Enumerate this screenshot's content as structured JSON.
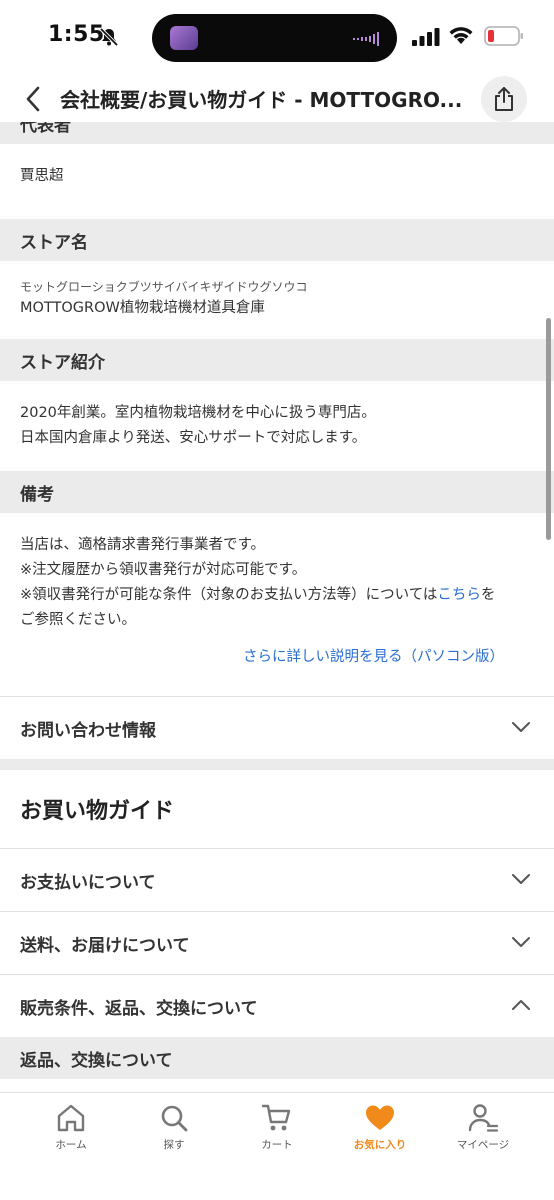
{
  "status": {
    "time": "1:55"
  },
  "nav": {
    "title": "会社概要/お買い物ガイド - MOTTOGRO..."
  },
  "representative": {
    "header": "代表者",
    "value": "賈思超"
  },
  "store_name": {
    "header": "ストア名",
    "kana": "モットグローショクブツサイバイキザイドウグソウコ",
    "value": "MOTTOGROW植物栽培機材道具倉庫"
  },
  "store_intro": {
    "header": "ストア紹介",
    "line1": "2020年創業。室内植物栽培機材を中心に扱う専門店。",
    "line2": "日本国内倉庫より発送、安心サポートで対応します。"
  },
  "remarks": {
    "header": "備考",
    "line1": "当店は、適格請求書発行事業者です。",
    "line2": "※注文履歴から領収書発行が対応可能です。",
    "line3_pre": "※領収書発行が可能な条件（対象のお支払い方法等）については",
    "line3_link": "こちら",
    "line3_post": "を",
    "line4": "ご参照ください。",
    "more_link": "さらに詳しい説明を見る（パソコン版）"
  },
  "contact": {
    "label": "お問い合わせ情報"
  },
  "guide": {
    "title": "お買い物ガイド",
    "payment": "お支払いについて",
    "shipping": "送料、お届けについて",
    "conditions": "販売条件、返品、交換について",
    "returns_header": "返品、交換について"
  },
  "tabs": [
    {
      "label": "ホーム",
      "icon": "home-icon"
    },
    {
      "label": "探す",
      "icon": "search-icon"
    },
    {
      "label": "カート",
      "icon": "cart-icon"
    },
    {
      "label": "お気に入り",
      "icon": "heart-icon"
    },
    {
      "label": "マイページ",
      "icon": "person-icon"
    }
  ],
  "colors": {
    "accent": "#f08a1a",
    "link": "#2a6fd1",
    "section_bg": "#ebebeb"
  }
}
